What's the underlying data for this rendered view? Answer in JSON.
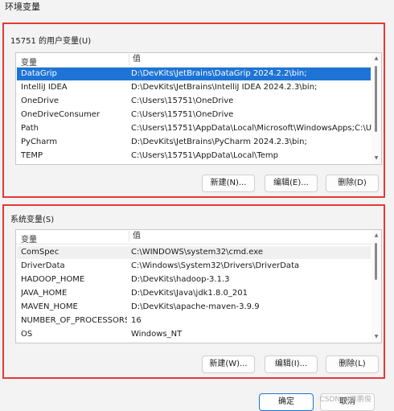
{
  "window": {
    "title": "环境变量"
  },
  "user_vars": {
    "group_title": "15751 的用户变量(U)",
    "columns": {
      "name": "变量",
      "value": "值"
    },
    "rows": [
      {
        "name": "DataGrip",
        "value": "D:\\DevKits\\JetBrains\\DataGrip 2024.2.2\\bin;"
      },
      {
        "name": "IntelliJ IDEA",
        "value": "D:\\DevKits\\JetBrains\\IntelliJ IDEA 2024.2.3\\bin;"
      },
      {
        "name": "OneDrive",
        "value": "C:\\Users\\15751\\OneDrive"
      },
      {
        "name": "OneDriveConsumer",
        "value": "C:\\Users\\15751\\OneDrive"
      },
      {
        "name": "Path",
        "value": "C:\\Users\\15751\\AppData\\Local\\Microsoft\\WindowsApps;C:\\U..."
      },
      {
        "name": "PyCharm",
        "value": "D:\\DevKits\\JetBrains\\PyCharm 2024.2.3\\bin;"
      },
      {
        "name": "TEMP",
        "value": "C:\\Users\\15751\\AppData\\Local\\Temp"
      }
    ],
    "buttons": {
      "new": "新建(N)...",
      "edit": "编辑(E)...",
      "delete": "删除(D)"
    }
  },
  "system_vars": {
    "group_title": "系统变量(S)",
    "columns": {
      "name": "变量",
      "value": "值"
    },
    "rows": [
      {
        "name": "ComSpec",
        "value": "C:\\WINDOWS\\system32\\cmd.exe"
      },
      {
        "name": "DriverData",
        "value": "C:\\Windows\\System32\\Drivers\\DriverData"
      },
      {
        "name": "HADOOP_HOME",
        "value": "D:\\DevKits\\hadoop-3.1.3"
      },
      {
        "name": "JAVA_HOME",
        "value": "D:\\DevKits\\Java\\jdk1.8.0_201"
      },
      {
        "name": "MAVEN_HOME",
        "value": "D:\\DevKits\\apache-maven-3.9.9"
      },
      {
        "name": "NUMBER_OF_PROCESSORS",
        "value": "16"
      },
      {
        "name": "OS",
        "value": "Windows_NT"
      }
    ],
    "buttons": {
      "new": "新建(W)...",
      "edit": "编辑(I)...",
      "delete": "删除(L)"
    }
  },
  "footer": {
    "ok": "确定",
    "cancel": "取消",
    "watermark": "CSDN @准鹏俊"
  },
  "colors": {
    "accent": "#1e74d6",
    "highlight_border": "#e53935"
  }
}
